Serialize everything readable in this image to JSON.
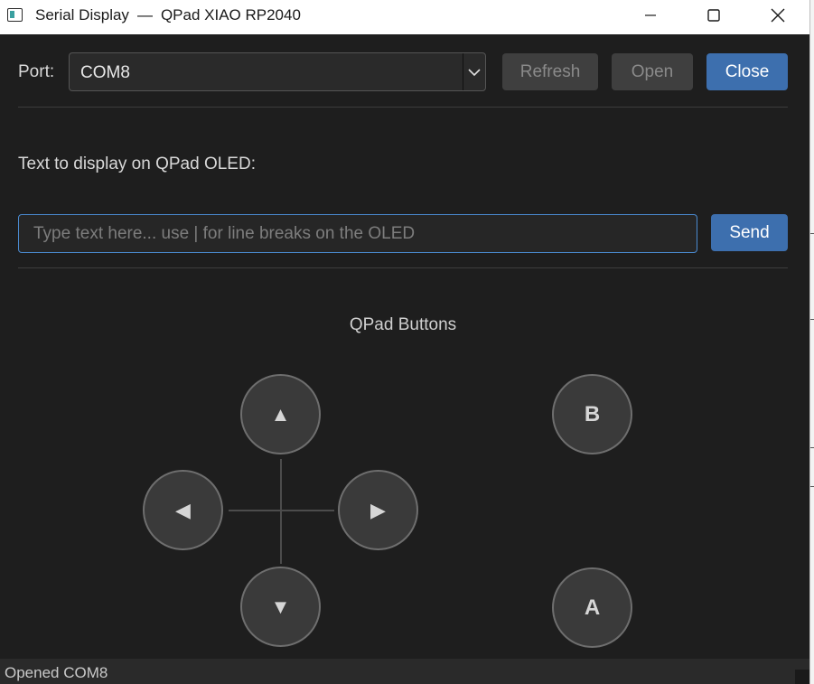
{
  "window": {
    "title_app": "Serial Display",
    "title_separator": "—",
    "title_device": "QPad XIAO RP2040",
    "controls": {
      "minimize_icon": "minimize-icon",
      "maximize_icon": "maximize-icon",
      "close_icon": "close-icon"
    }
  },
  "port": {
    "label": "Port:",
    "selected": "COM8",
    "refresh_label": "Refresh",
    "open_label": "Open",
    "close_label": "Close",
    "refresh_enabled": false,
    "open_enabled": false,
    "close_enabled": true
  },
  "oled": {
    "label": "Text to display on QPad OLED:",
    "input_value": "",
    "placeholder": "Type text here... use | for line breaks on the OLED",
    "send_label": "Send"
  },
  "qpad": {
    "title": "QPad Buttons",
    "dpad": {
      "up_icon": "▲",
      "left_icon": "◀",
      "right_icon": "▶",
      "down_icon": "▼"
    },
    "b_label": "B",
    "a_label": "A"
  },
  "status": {
    "text": "Opened COM8"
  },
  "colors": {
    "background": "#1e1e1e",
    "accent": "#3d6fae",
    "focus_border": "#4a8ad0",
    "disabled_button": "#3f3f3f",
    "round_button": "#3a3a3a"
  }
}
